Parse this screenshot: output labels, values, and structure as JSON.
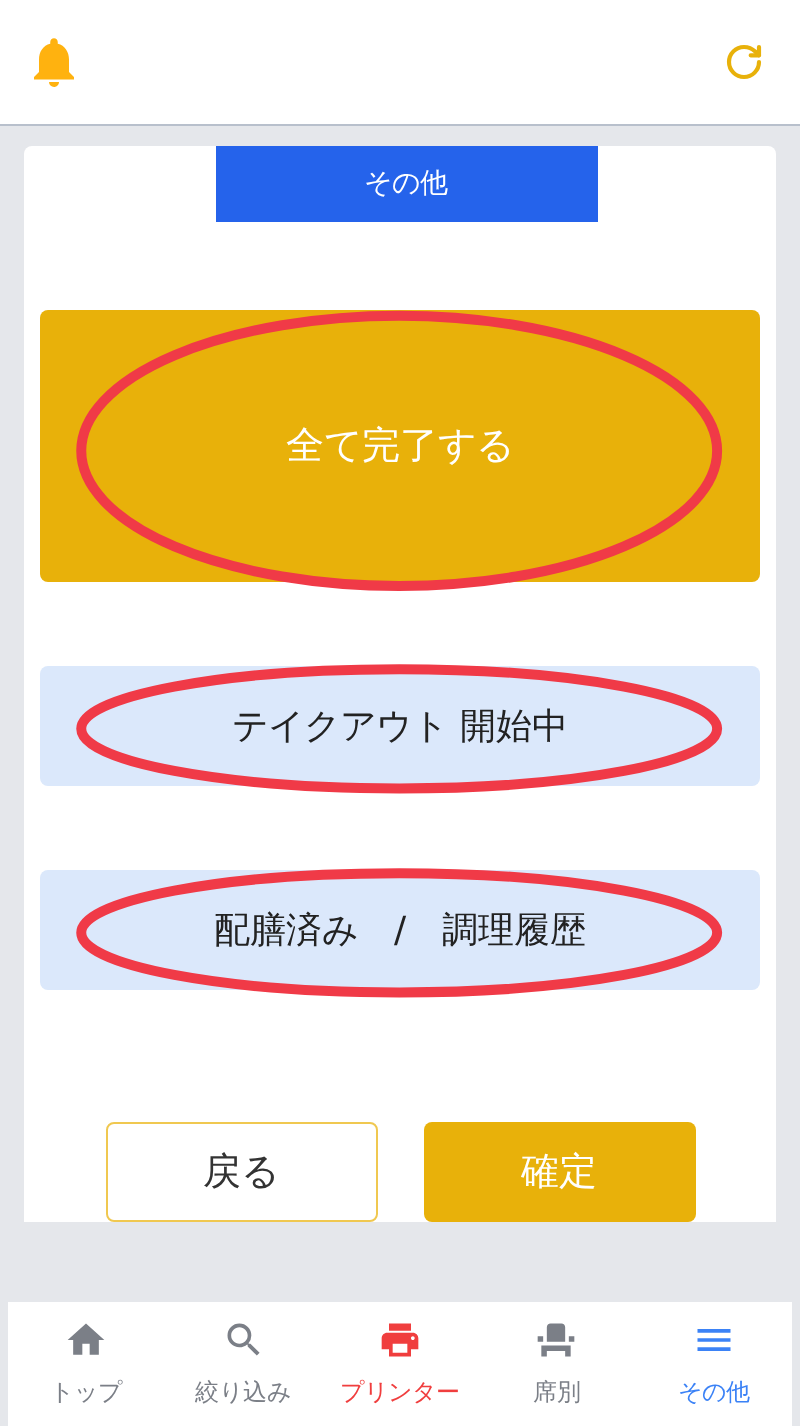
{
  "section_title": "その他",
  "actions": [
    {
      "label": "全て完了する",
      "kind": "primary",
      "highlighted": true
    },
    {
      "label": "テイクアウト 開始中",
      "kind": "secondary",
      "highlighted": true
    },
    {
      "label": "配膳済み　/　調理履歴",
      "kind": "secondary",
      "highlighted": true
    }
  ],
  "footer_buttons": [
    {
      "label": "戻る",
      "kind": "outline"
    },
    {
      "label": "確定",
      "kind": "filled"
    }
  ],
  "nav": [
    {
      "label": "トップ",
      "color": "#7b7f87"
    },
    {
      "label": "絞り込み",
      "color": "#7b7f87"
    },
    {
      "label": "プリンター",
      "color": "#f03e3e"
    },
    {
      "label": "席別",
      "color": "#7b7f87"
    },
    {
      "label": "その他",
      "color": "#3b82f6"
    }
  ]
}
